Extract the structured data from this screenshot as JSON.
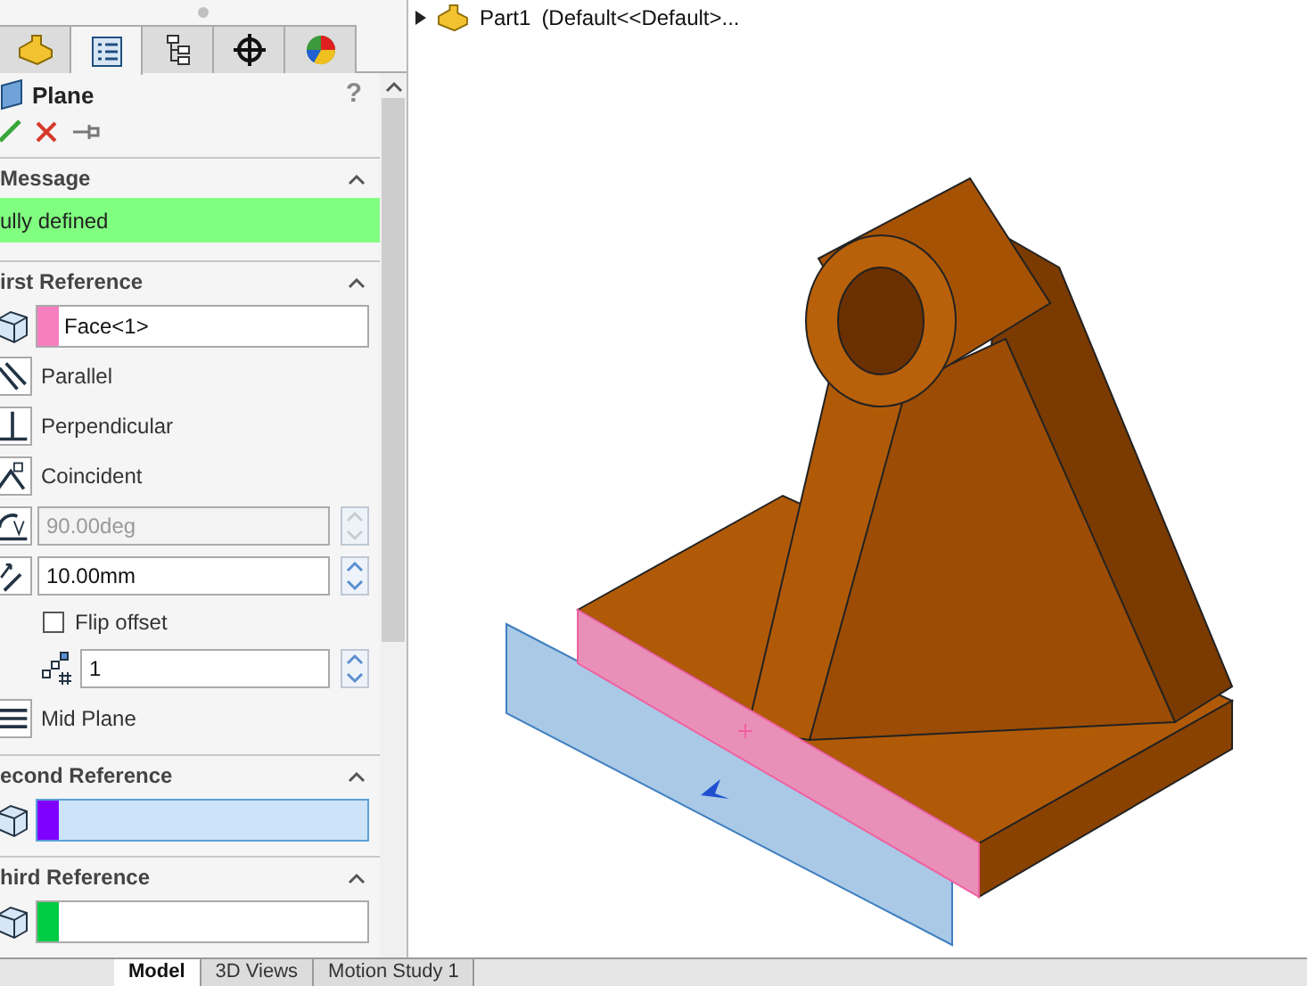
{
  "panel_tabs": [
    {
      "kind": "part",
      "selected": false
    },
    {
      "kind": "property",
      "selected": true
    },
    {
      "kind": "config",
      "selected": false
    },
    {
      "kind": "target",
      "selected": false
    },
    {
      "kind": "appearance",
      "selected": false
    }
  ],
  "feature": {
    "title": "Plane",
    "help": "?"
  },
  "message": {
    "header": "Message",
    "text": "ully defined",
    "expanded": true
  },
  "references": [
    {
      "header": "irst Reference",
      "expanded": true,
      "value": "Face<1>",
      "color": "#f77fbf",
      "selected": false,
      "options": [
        {
          "kind": "toggle",
          "label": "Parallel"
        },
        {
          "kind": "toggle",
          "label": "Perpendicular"
        },
        {
          "kind": "toggle",
          "label": "Coincident"
        },
        {
          "kind": "spin",
          "value": "90.00deg",
          "disabled": true
        },
        {
          "kind": "spin",
          "value": "10.00mm",
          "disabled": false
        },
        {
          "kind": "checkbox",
          "label": "Flip offset",
          "checked": false
        },
        {
          "kind": "spin",
          "value": "1",
          "disabled": false
        },
        {
          "kind": "toggle",
          "label": "Mid Plane"
        }
      ]
    },
    {
      "header": "econd Reference",
      "expanded": true,
      "color": "#7f00ff",
      "selected": true
    },
    {
      "header": "hird Reference",
      "expanded": true,
      "color": "#00cc44",
      "selected": false
    }
  ],
  "tree_header": {
    "label": "Part1",
    "config": "(Default<<Default>..."
  },
  "bottom_tabs": [
    {
      "label": "Model",
      "selected": true
    },
    {
      "label": "3D Views",
      "selected": false
    },
    {
      "label": "Motion Study 1",
      "selected": false
    }
  ]
}
